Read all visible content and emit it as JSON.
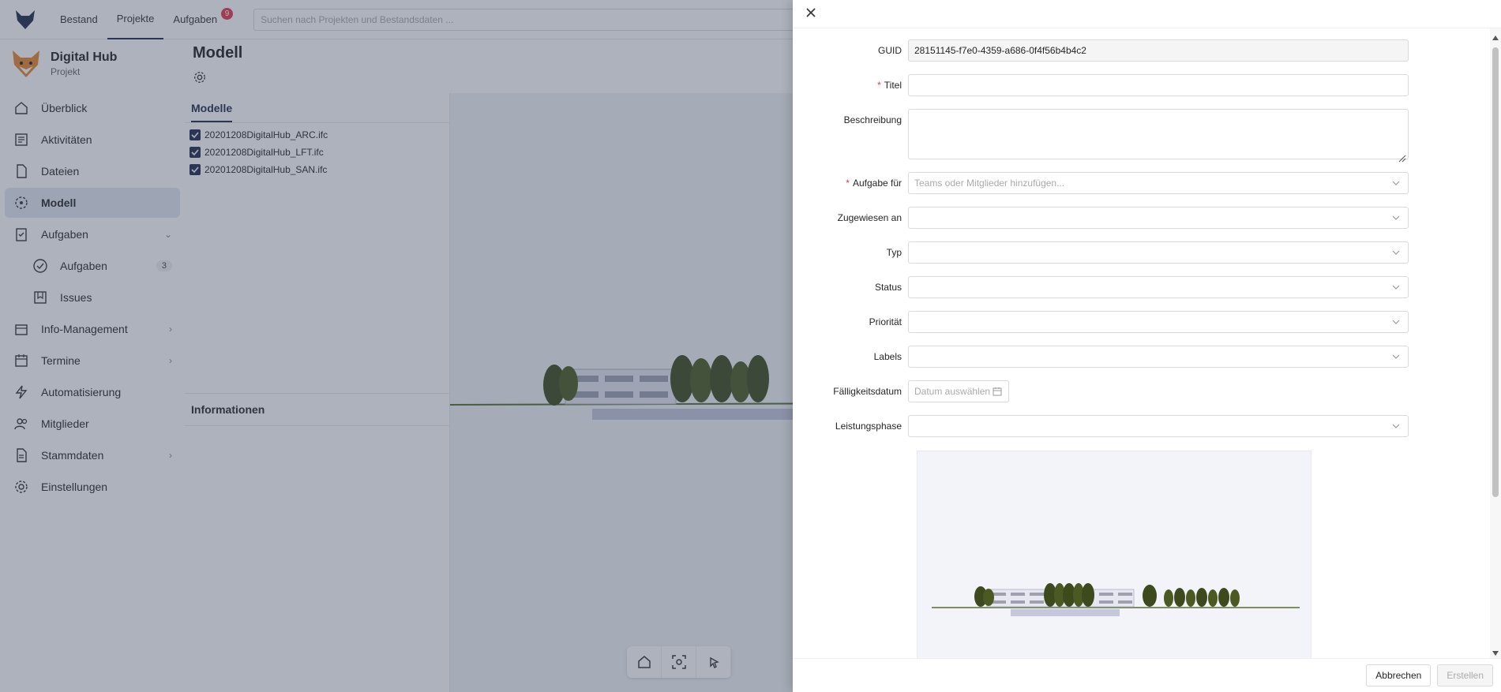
{
  "topbar": {
    "nav": [
      {
        "label": "Bestand"
      },
      {
        "label": "Projekte"
      },
      {
        "label": "Aufgaben",
        "badge": "9"
      }
    ],
    "search_placeholder": "Suchen nach Projekten und Bestandsdaten ..."
  },
  "sidebar": {
    "project_name": "Digital Hub",
    "project_sub": "Projekt",
    "items": [
      {
        "label": "Überblick"
      },
      {
        "label": "Aktivitäten"
      },
      {
        "label": "Dateien"
      },
      {
        "label": "Modell"
      },
      {
        "label": "Aufgaben"
      },
      {
        "label": "Aufgaben",
        "count": "3"
      },
      {
        "label": "Issues"
      },
      {
        "label": "Info-Management"
      },
      {
        "label": "Termine"
      },
      {
        "label": "Automatisierung"
      },
      {
        "label": "Mitglieder"
      },
      {
        "label": "Stammdaten"
      },
      {
        "label": "Einstellungen"
      }
    ]
  },
  "main": {
    "title": "Modell",
    "tab_label": "Modelle",
    "models": [
      "20201208DigitalHub_ARC.ifc",
      "20201208DigitalHub_LFT.ifc",
      "20201208DigitalHub_SAN.ifc"
    ],
    "info_label": "Informationen"
  },
  "form": {
    "guid_label": "GUID",
    "guid_value": "28151145-f7e0-4359-a686-0f4f56b4b4c2",
    "title_label": "Titel",
    "desc_label": "Beschreibung",
    "assignee_for_label": "Aufgabe für",
    "assignee_for_placeholder": "Teams oder Mitglieder hinzufügen...",
    "assigned_to_label": "Zugewiesen an",
    "type_label": "Typ",
    "status_label": "Status",
    "priority_label": "Priorität",
    "labels_label": "Labels",
    "due_label": "Fälligkeitsdatum",
    "due_placeholder": "Datum auswählen",
    "phase_label": "Leistungsphase"
  },
  "footer": {
    "cancel": "Abbrechen",
    "create": "Erstellen"
  },
  "colors": {
    "accent": "#1f2a4d",
    "required": "#e8364a",
    "overlay": "#3c485f"
  }
}
